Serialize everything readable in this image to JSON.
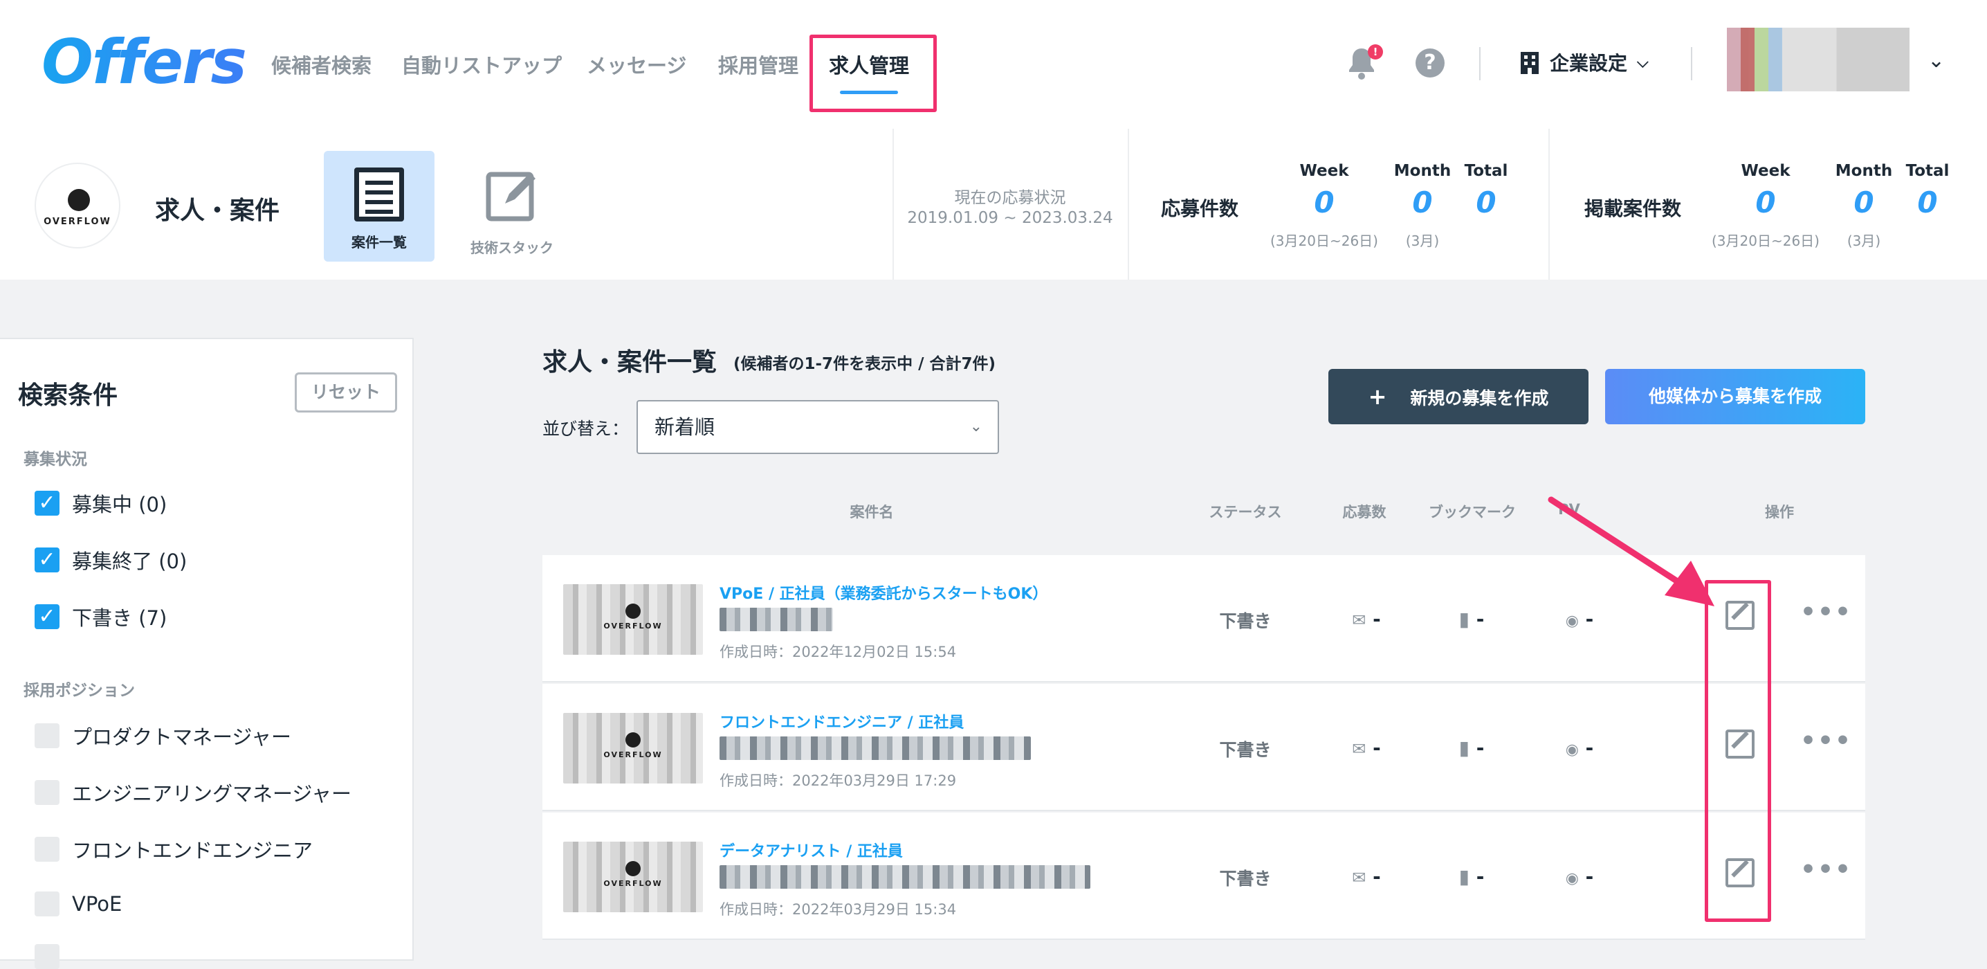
{
  "app": {
    "logo": "Offers"
  },
  "nav": {
    "items": [
      {
        "label": "候補者検索"
      },
      {
        "label": "自動リストアップ"
      },
      {
        "label": "メッセージ"
      },
      {
        "label": "採用管理"
      },
      {
        "label": "求人管理",
        "active": true
      }
    ],
    "notification_badge": "!",
    "help": "?",
    "company_settings": "企業設定"
  },
  "header": {
    "company_logo_text": "OVERFLOW",
    "section_title": "求人・案件",
    "tiles": [
      {
        "label": "案件一覧",
        "active": true
      },
      {
        "label": "技術スタック",
        "active": false
      }
    ],
    "current_status_label": "現在の応募状況",
    "current_status_range": "2019.01.09 ~ 2023.03.24",
    "applications": {
      "label": "応募件数",
      "week_label": "Week",
      "month_label": "Month",
      "total_label": "Total",
      "week": "0",
      "month": "0",
      "total": "0",
      "week_note": "(3月20日~26日)",
      "month_note": "(3月)"
    },
    "listings": {
      "label": "掲載案件数",
      "week_label": "Week",
      "month_label": "Month",
      "total_label": "Total",
      "week": "0",
      "month": "0",
      "total": "0",
      "week_note": "(3月20日~26日)",
      "month_note": "(3月)"
    }
  },
  "sidebar": {
    "title": "検索条件",
    "reset_label": "リセット",
    "status_section": "募集状況",
    "statuses": [
      {
        "label": "募集中 (0)",
        "checked": true
      },
      {
        "label": "募集終了 (0)",
        "checked": true
      },
      {
        "label": "下書き (7)",
        "checked": true
      }
    ],
    "position_section": "採用ポジション",
    "positions": [
      {
        "label": "プロダクトマネージャー",
        "checked": false
      },
      {
        "label": "エンジニアリングマネージャー",
        "checked": false
      },
      {
        "label": "フロントエンドエンジニア",
        "checked": false
      },
      {
        "label": "VPoE",
        "checked": false
      }
    ]
  },
  "main": {
    "title": "求人・案件一覧",
    "subtitle": "(候補者の1-7件を表示中 / 合計7件)",
    "sort_label": "並び替え：",
    "sort_value": "新着順",
    "new_button": "新規の募集を作成",
    "new_button_icon": "+",
    "import_button": "他媒体から募集を作成",
    "columns": {
      "name": "案件名",
      "status": "ステータス",
      "applications": "応募数",
      "bookmarks": "ブックマーク",
      "pv": "PV",
      "actions": "操作"
    },
    "rows": [
      {
        "title": "VPoE / 正社員（業務委託からスタートもOK）",
        "created": "作成日時：2022年12月02日 15:54",
        "status": "下書き",
        "applications": "-",
        "bookmarks": "-",
        "pv": "-"
      },
      {
        "title": "フロントエンドエンジニア / 正社員",
        "created": "作成日時：2022年03月29日 17:29",
        "status": "下書き",
        "applications": "-",
        "bookmarks": "-",
        "pv": "-"
      },
      {
        "title": "データアナリスト / 正社員",
        "created": "作成日時：2022年03月29日 15:34",
        "status": "下書き",
        "applications": "-",
        "bookmarks": "-",
        "pv": "-"
      }
    ],
    "thumb_logo_text": "OVERFLOW"
  },
  "colors": {
    "accent": "#2f9df6",
    "highlight": "#f0306e",
    "dark_button": "#33495a"
  }
}
